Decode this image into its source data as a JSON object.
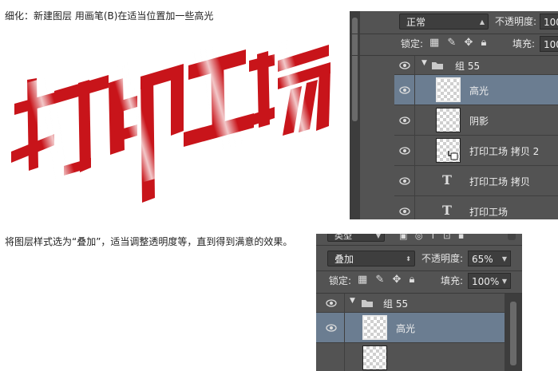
{
  "captions": {
    "step1": "细化：新建图层 用画笔(B)在适当位置加一些高光",
    "step2": "将图层样式选为“叠加”，适当调整透明度等，直到得到满意的效果。"
  },
  "artwork": {
    "text": "打印工场",
    "color": "#c8141a"
  },
  "panel1": {
    "blend_mode": "正常",
    "opacity_label": "不透明度:",
    "opacity_value": "100",
    "lock_label": "锁定:",
    "fill_label": "填充:",
    "fill_value": "100",
    "layers": [
      {
        "name": "组 55",
        "type": "group"
      },
      {
        "name": "高光",
        "type": "pixel",
        "selected": true
      },
      {
        "name": "阴影",
        "type": "pixel"
      },
      {
        "name": "打印工场 拷贝 2",
        "type": "pixel"
      },
      {
        "name": "打印工场 拷贝",
        "type": "text"
      },
      {
        "name": "打印工场",
        "type": "text"
      }
    ]
  },
  "panel2": {
    "filter_label": "类型",
    "blend_mode": "叠加",
    "opacity_label": "不透明度:",
    "opacity_value": "65%",
    "lock_label": "锁定:",
    "fill_label": "填充:",
    "fill_value": "100%",
    "layers": [
      {
        "name": "组 55",
        "type": "group"
      },
      {
        "name": "高光",
        "type": "pixel",
        "selected": true
      }
    ]
  },
  "icons": {
    "eye": "eye-icon",
    "folder": "folder-icon",
    "text_layer": "text-layer-icon",
    "lock": "lock-icon"
  },
  "colors": {
    "panel_bg": "#535353",
    "selected_row": "#6b7d91",
    "art_red": "#c8141a"
  }
}
